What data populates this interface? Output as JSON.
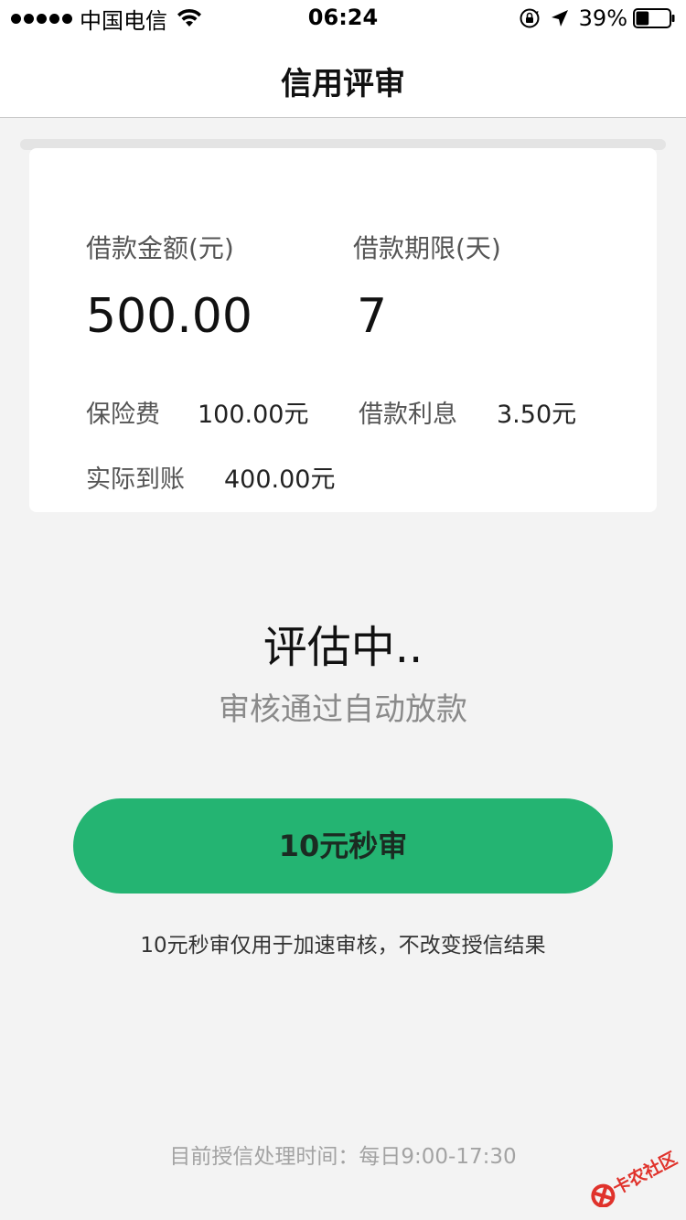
{
  "status_bar": {
    "carrier": "中国电信",
    "time": "06:24",
    "battery": "39%",
    "battery_level": 0.39,
    "icons": [
      "signal-dots",
      "wifi-icon",
      "rotation-lock-icon",
      "location-arrow-icon",
      "battery-icon"
    ]
  },
  "nav": {
    "title": "信用评审"
  },
  "loan": {
    "amount_label": "借款金额(元)",
    "amount_value": "500.00",
    "term_label": "借款期限(天)",
    "term_value": "7",
    "insurance_label": "保险费",
    "insurance_value": "100.00元",
    "interest_label": "借款利息",
    "interest_value": "3.50元",
    "received_label": "实际到账",
    "received_value": "400.00元"
  },
  "status": {
    "title": "评估中..",
    "subtitle": "审核通过自动放款"
  },
  "action": {
    "button_label": "10元秒审",
    "note": "10元秒审仅用于加速审核，不改变授信结果"
  },
  "footer": {
    "hours": "目前授信处理时间：每日9:00-17:30"
  },
  "watermark": {
    "text": "卡农社区"
  },
  "colors": {
    "accent": "#24b472",
    "background": "#f3f3f3",
    "card": "#ffffff",
    "watermark": "#e0322b"
  }
}
